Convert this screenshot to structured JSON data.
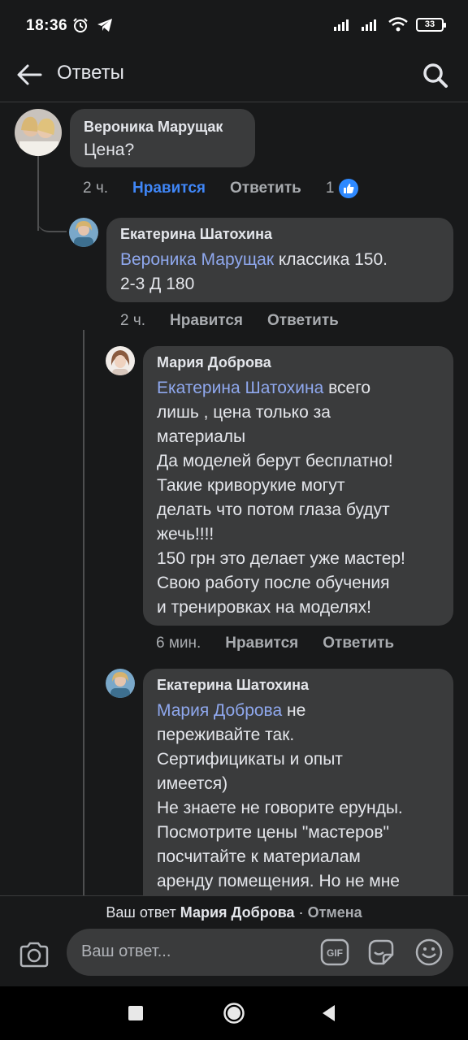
{
  "status_bar": {
    "time": "18:36",
    "battery": "33",
    "left_icons": [
      "alarm-icon",
      "telegram-icon"
    ],
    "right_icons": [
      "signal-icon",
      "signal-icon",
      "wifi-icon",
      "battery-icon"
    ]
  },
  "header": {
    "title": "Ответы",
    "back_icon": "arrow-left-icon",
    "search_icon": "search-icon"
  },
  "comments": [
    {
      "author": "Вероника Марущак",
      "text": "Цена?",
      "time": "2 ч.",
      "like_label": "Нравится",
      "reply_label": "Ответить",
      "reaction_count": "1",
      "reaction_icon": "thumbs-up-icon"
    },
    {
      "author": "Екатерина Шатохина",
      "mention": "Вероника Марущак",
      "text": " классика 150.\n2-3 Д 180",
      "time": "2 ч.",
      "like_label": "Нравится",
      "reply_label": "Ответить"
    },
    {
      "author": "Мария Доброва",
      "mention": "Екатерина Шатохина",
      "text": " всего\nлишь , цена только за\nматериалы\nДа моделей берут бесплатно!\nТакие криворукие могут\nделать что потом глаза будут\nжечь!!!!\n150 грн это делает уже мастер!\nСвою  работу после  обучения\nи тренировках на моделях!",
      "time": "6 мин.",
      "like_label": "Нравится",
      "reply_label": "Ответить"
    },
    {
      "author": "Екатерина Шатохина",
      "mention": "Мария Доброва",
      "text": " не\nпереживайте так.\nСертифицикаты и опыт\nимеется)\nНе знаете не говорите ерунды.\nПосмотрите цены \"мастеров\"\nпосчитайте к материалам\nаренду помещения. Но не мне"
    }
  ],
  "reply_bar": {
    "prefix": "Ваш ответ",
    "name": "Мария Доброва",
    "separator": "·",
    "cancel": "Отмена",
    "placeholder": "Ваш ответ...",
    "camera_icon": "camera-icon",
    "gif_icon": "gif-icon",
    "sticker_icon": "sticker-icon",
    "emoji_icon": "emoji-icon"
  },
  "nav_bar": {
    "icons": [
      "recents-square-icon",
      "home-circle-icon",
      "back-triangle-icon"
    ]
  },
  "colors": {
    "background": "#18191a",
    "bubble": "#3a3b3c",
    "mention": "#8fa8ee",
    "active_like": "#3f86f7",
    "secondary_text": "#a8abaf"
  }
}
